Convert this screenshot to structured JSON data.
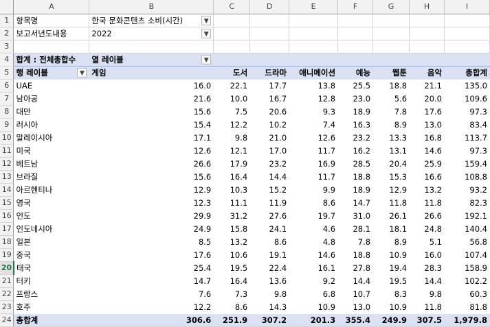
{
  "columns": [
    "A",
    "B",
    "C",
    "D",
    "E",
    "F",
    "G",
    "H",
    "I"
  ],
  "filters": [
    {
      "label": "항목명",
      "value": "한국 문화콘텐츠 소비(시간)"
    },
    {
      "label": "보고서년도내용",
      "value": "2022"
    }
  ],
  "pivot": {
    "values_label": "합계 : 전체총합수",
    "col_labels": "열 레이블",
    "row_labels": "행 레이블",
    "headers": [
      "게임",
      "도서",
      "드라마",
      "애니메이션",
      "예능",
      "웹툰",
      "음악",
      "총합계"
    ],
    "rows": [
      {
        "name": "UAE",
        "v": [
          "16.0",
          "22.1",
          "17.7",
          "13.8",
          "25.5",
          "18.8",
          "21.1",
          "135.0"
        ]
      },
      {
        "name": "남아공",
        "v": [
          "21.6",
          "10.0",
          "16.7",
          "12.8",
          "23.0",
          "5.6",
          "20.0",
          "109.6"
        ]
      },
      {
        "name": "대만",
        "v": [
          "15.6",
          "7.5",
          "20.6",
          "9.3",
          "18.9",
          "7.8",
          "17.6",
          "97.3"
        ]
      },
      {
        "name": "러시아",
        "v": [
          "15.4",
          "12.2",
          "10.2",
          "7.4",
          "16.3",
          "8.9",
          "13.0",
          "83.4"
        ]
      },
      {
        "name": "말레이시아",
        "v": [
          "17.1",
          "9.8",
          "21.0",
          "12.6",
          "23.2",
          "13.3",
          "16.8",
          "113.7"
        ]
      },
      {
        "name": "미국",
        "v": [
          "12.6",
          "12.1",
          "17.0",
          "11.7",
          "16.2",
          "13.1",
          "14.6",
          "97.3"
        ]
      },
      {
        "name": "베트남",
        "v": [
          "26.6",
          "17.9",
          "23.2",
          "16.9",
          "28.5",
          "20.4",
          "25.9",
          "159.4"
        ]
      },
      {
        "name": "브라질",
        "v": [
          "15.6",
          "16.4",
          "14.4",
          "11.7",
          "18.8",
          "15.3",
          "16.6",
          "108.8"
        ]
      },
      {
        "name": "아르헨티나",
        "v": [
          "12.9",
          "10.3",
          "15.2",
          "9.9",
          "18.9",
          "12.9",
          "13.2",
          "93.2"
        ]
      },
      {
        "name": "영국",
        "v": [
          "12.3",
          "11.1",
          "11.9",
          "8.6",
          "14.7",
          "11.8",
          "11.8",
          "82.3"
        ]
      },
      {
        "name": "인도",
        "v": [
          "29.9",
          "31.2",
          "27.6",
          "19.7",
          "31.0",
          "26.1",
          "26.6",
          "192.1"
        ]
      },
      {
        "name": "인도네시아",
        "v": [
          "24.9",
          "15.8",
          "24.1",
          "4.6",
          "28.1",
          "18.1",
          "24.8",
          "140.4"
        ]
      },
      {
        "name": "일본",
        "v": [
          "8.5",
          "13.2",
          "8.6",
          "4.8",
          "7.8",
          "8.9",
          "5.1",
          "56.8"
        ]
      },
      {
        "name": "중국",
        "v": [
          "17.6",
          "10.6",
          "19.1",
          "14.6",
          "18.8",
          "10.9",
          "16.0",
          "107.4"
        ]
      },
      {
        "name": "태국",
        "v": [
          "25.4",
          "19.5",
          "22.4",
          "16.1",
          "27.8",
          "19.4",
          "28.3",
          "158.9"
        ]
      },
      {
        "name": "터키",
        "v": [
          "14.7",
          "16.4",
          "13.6",
          "9.2",
          "14.4",
          "19.5",
          "14.4",
          "102.2"
        ]
      },
      {
        "name": "프랑스",
        "v": [
          "7.6",
          "7.3",
          "9.8",
          "6.8",
          "10.7",
          "8.3",
          "9.8",
          "60.3"
        ]
      },
      {
        "name": "호주",
        "v": [
          "12.2",
          "8.6",
          "14.3",
          "10.9",
          "13.0",
          "10.9",
          "11.8",
          "81.8"
        ]
      }
    ],
    "total": {
      "name": "총합계",
      "v": [
        "306.6",
        "251.9",
        "307.2",
        "201.3",
        "355.4",
        "249.9",
        "307.5",
        "1,979.8"
      ]
    }
  },
  "row_numbers": [
    "1",
    "2",
    "3",
    "4",
    "5",
    "6",
    "7",
    "8",
    "9",
    "10",
    "11",
    "12",
    "13",
    "14",
    "15",
    "16",
    "17",
    "18",
    "19",
    "20",
    "21",
    "22",
    "23",
    "24"
  ],
  "active_row": "20",
  "filter_icon": "funnel-filter-icon",
  "dropdown_icon": "dropdown-arrow-icon",
  "colors": {
    "band": "#d9e1f2",
    "band_border": "#8ea9db",
    "active": "#217346"
  }
}
